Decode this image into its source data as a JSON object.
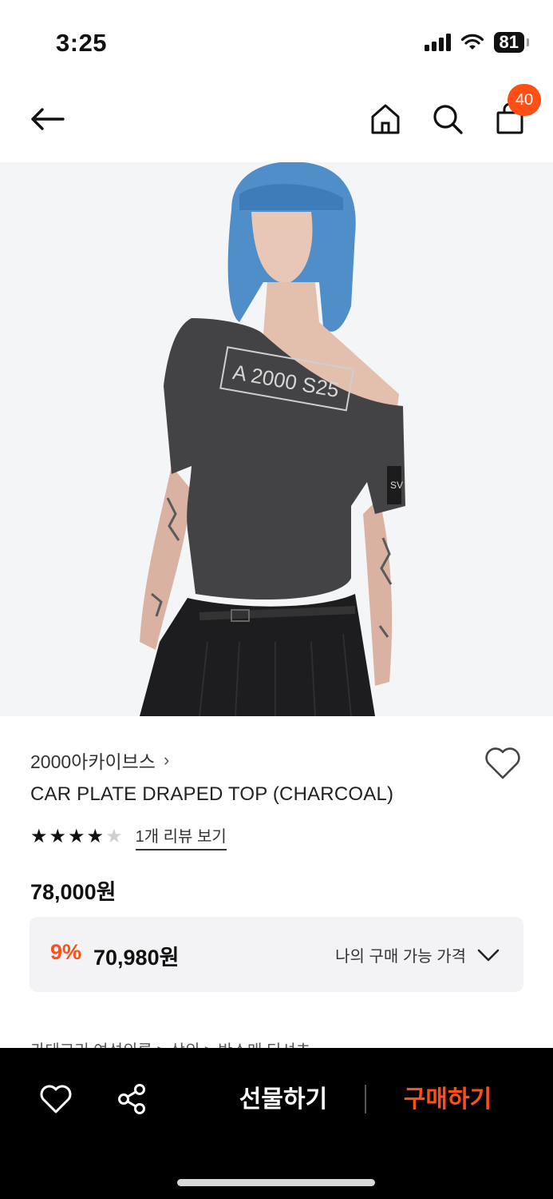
{
  "status_bar": {
    "time": "3:25",
    "battery": "81"
  },
  "nav": {
    "cart_count": "40"
  },
  "product": {
    "brand": "2000아카이브스",
    "brand_chevron": "›",
    "title": "CAR PLATE DRAPED TOP (CHARCOAL)",
    "rating": 4,
    "rating_max": 5,
    "review_link": "1개 리뷰 보기",
    "price": "78,000원",
    "discount_rate": "9%",
    "discount_price": "70,980원",
    "price_option_label": "나의 구매 가능 가격",
    "category_peek": "카테고리          여성의류  >  상의  >  반소매 티셔츠"
  },
  "image_print": {
    "plate_text": "A 2000 S25",
    "sleeve_label": "SV"
  },
  "bottom_bar": {
    "gift_label": "선물하기",
    "buy_label": "구매하기"
  },
  "colors": {
    "accent": "#ff4f14",
    "bottom_bar_bg": "#000000",
    "discount_box_bg": "#f3f3f5"
  }
}
